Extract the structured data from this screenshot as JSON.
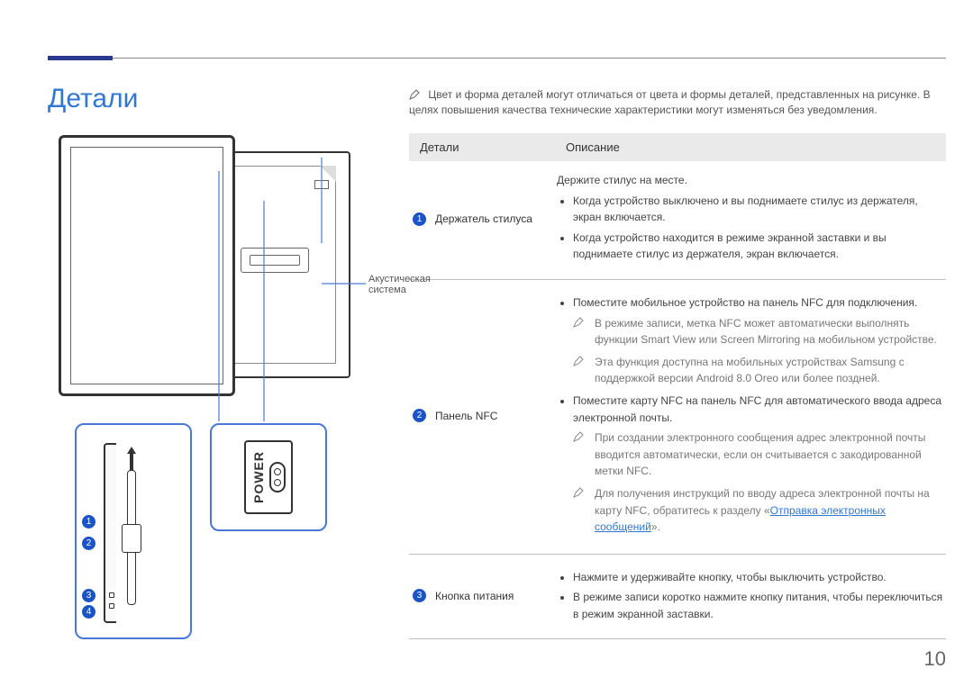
{
  "title": "Детали",
  "intro_note": "Цвет и форма деталей могут отличаться от цвета и формы деталей, представленных на рисунке. В целях повышения качества технические характеристики могут изменяться без уведомления.",
  "table": {
    "headers": {
      "parts": "Детали",
      "desc": "Описание"
    },
    "rows": [
      {
        "num": "1",
        "name": "Держатель стилуса",
        "lead": "Держите стилус на месте.",
        "bullets": [
          "Когда устройство выключено и вы поднимаете стилус из держателя, экран включается.",
          "Когда устройство находится в режиме экранной заставки и вы поднимаете стилус из держателя, экран включается."
        ]
      },
      {
        "num": "2",
        "name": "Панель NFC",
        "bullets_top": [
          "Поместите мобильное устройство на панель NFC для подключения."
        ],
        "note1": "В режиме записи, метка NFC может автоматически выполнять функции Smart View или Screen Mirroring на мобильном устройстве.",
        "note2": "Эта функция доступна на мобильных устройствах Samsung с поддержкой версии Android 8.0 Oreo или более поздней.",
        "bullets_mid": [
          "Поместите карту NFC на панель NFC для автоматического ввода адреса электронной почты."
        ],
        "note3": "При создании электронного сообщения адрес электронной почты вводится автоматически, если он считывается с закодированной метки NFC.",
        "note4_pre": "Для получения инструкций по вводу адреса электронной почты на карту NFC, обратитесь к разделу «",
        "note4_link": "Отправка электронных сообщений",
        "note4_post": "»."
      },
      {
        "num": "3",
        "name": "Кнопка питания",
        "bullets": [
          "Нажмите и удерживайте кнопку, чтобы выключить устройство.",
          "В режиме записи коротко нажмите кнопку питания, чтобы переключиться в режим экранной заставки."
        ]
      }
    ]
  },
  "diagram": {
    "speaker_label": "Акустическая система",
    "power_label": "POWER",
    "callouts": [
      "1",
      "2",
      "3",
      "4"
    ]
  },
  "page_number": "10"
}
